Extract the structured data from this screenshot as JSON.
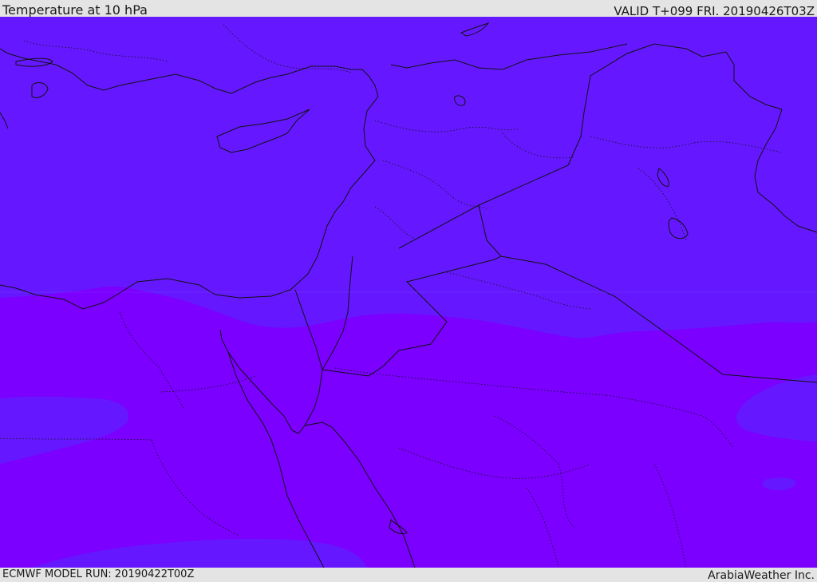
{
  "header": {
    "title": "Temperature at 10 hPa",
    "valid_time": "VALID T+099 FRI. 20190426T03Z"
  },
  "footer": {
    "model_run": "ECMWF MODEL RUN: 20190422T00Z",
    "credit": "ArabiaWeather Inc."
  },
  "map": {
    "field": "temperature",
    "level": "10 hPa",
    "colors": {
      "cooler_band": "#6518ff",
      "warmer_band": "#7b00ff",
      "coastline": "#111111",
      "border": "#111111"
    }
  }
}
